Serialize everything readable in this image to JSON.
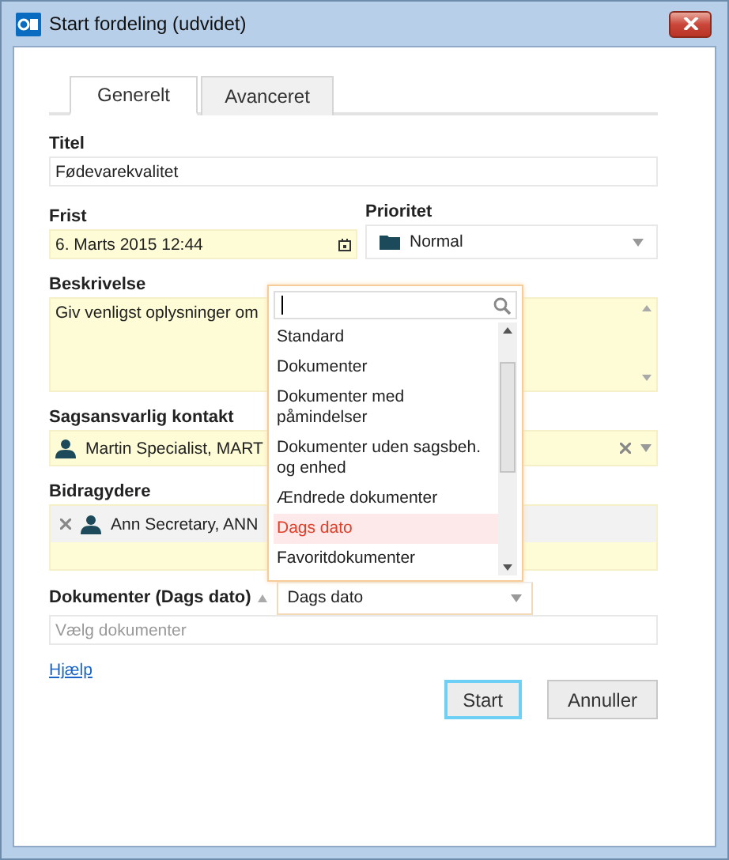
{
  "window": {
    "title": "Start fordeling (udvidet)"
  },
  "tabs": [
    {
      "label": "Generelt",
      "selected": true
    },
    {
      "label": "Avanceret",
      "selected": false
    }
  ],
  "title_field": {
    "label": "Titel",
    "value": "Fødevarekvalitet"
  },
  "deadline": {
    "label": "Frist",
    "value": "6. Marts 2015 12:44"
  },
  "priority": {
    "label": "Prioritet",
    "value": "Normal"
  },
  "description": {
    "label": "Beskrivelse",
    "value": "Giv venligst oplysninger om"
  },
  "responsible_contact": {
    "label": "Sagsansvarlig kontakt",
    "value": "Martin Specialist, MART"
  },
  "contributors": {
    "label": "Bidragydere",
    "items": [
      "Ann Secretary, ANN"
    ]
  },
  "documents": {
    "label": "Dokumenter (Dags dato)",
    "placeholder": "Vælg dokumenter",
    "filter": "Dags dato",
    "dropdown": {
      "expanded": true,
      "options": [
        {
          "label": "Standard",
          "selected": false
        },
        {
          "label": "Dokumenter",
          "selected": false
        },
        {
          "label": "Dokumenter med påmindelser",
          "selected": false
        },
        {
          "label": "Dokumenter uden sagsbeh. og enhed",
          "selected": false
        },
        {
          "label": "Ændrede dokumenter",
          "selected": false
        },
        {
          "label": "Dags dato",
          "selected": true
        },
        {
          "label": "Favoritdokumenter",
          "selected": false
        }
      ]
    }
  },
  "help_link": "Hjælp",
  "buttons": [
    {
      "label": "Start",
      "kind": "primary"
    },
    {
      "label": "Annuller",
      "kind": "secondary"
    }
  ]
}
